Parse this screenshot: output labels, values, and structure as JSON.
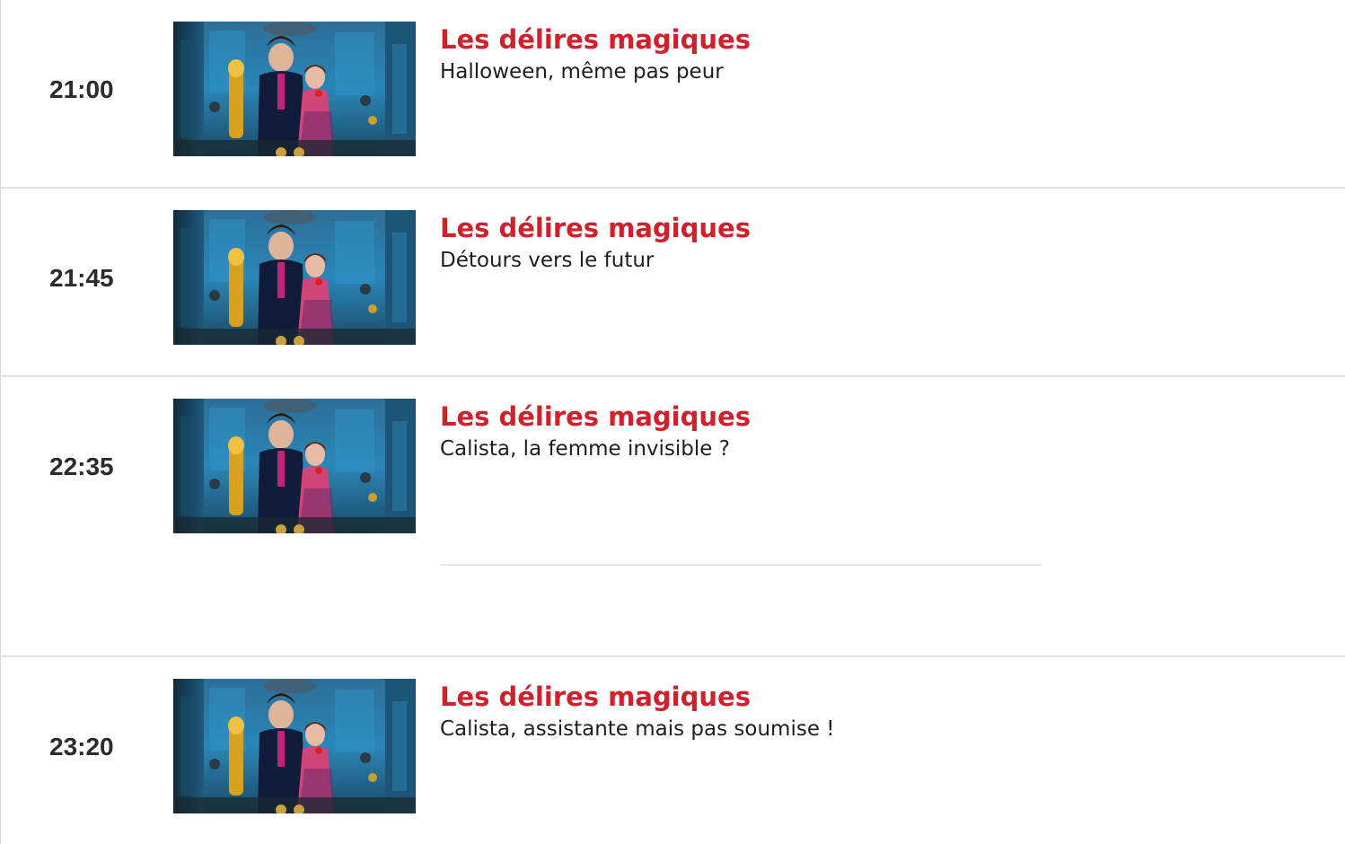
{
  "programs": [
    {
      "time": "21:00",
      "title": "Les délires magiques",
      "subtitle": "Halloween, même pas peur"
    },
    {
      "time": "21:45",
      "title": "Les délires magiques",
      "subtitle": "Détours vers le futur"
    },
    {
      "time": "22:35",
      "title": "Les délires magiques",
      "subtitle": "Calista, la femme invisible ?"
    },
    {
      "time": "23:20",
      "title": "Les délires magiques",
      "subtitle": "Calista, assistante mais pas soumise !"
    }
  ],
  "colors": {
    "title": "#d0202b",
    "time": "#2b2b2b",
    "subtitle": "#1e1e1e",
    "divider": "#e3e3e3"
  },
  "thumbnail_icon": "tv-show-still-image"
}
